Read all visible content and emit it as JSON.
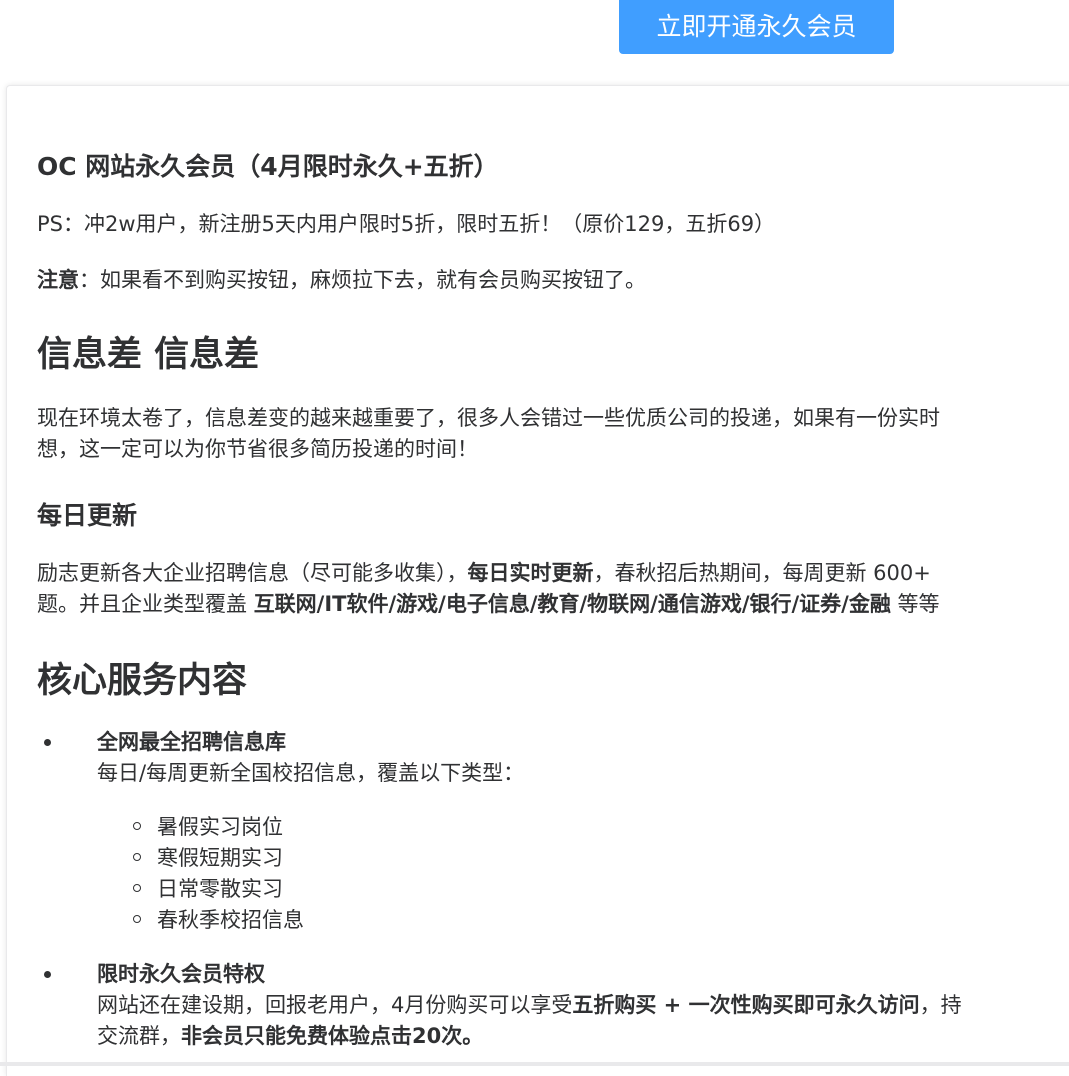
{
  "header": {
    "vip_button_label": "立即开通永久会员"
  },
  "intro": {
    "title": "OC 网站永久会员（4月限时永久+五折）",
    "ps_text": "PS：冲2w用户，新注册5天内用户限时5折，限时五折！（原价129，五折69）",
    "notice_label": "注意",
    "notice_text": "：如果看不到购买按钮，麻烦拉下去，就有会员购买按钮了。"
  },
  "info_gap": {
    "heading": "信息差 信息差",
    "line1": "现在环境太卷了，信息差变的越来越重要了，很多人会错过一些优质公司的投递，如果有一份实时",
    "line2": "想，这一定可以为你节省很多简历投递的时间！"
  },
  "daily": {
    "heading": "每日更新",
    "line1_a": "励志更新各大企业招聘信息（尽可能多收集），",
    "line1_b": "每日实时更新",
    "line1_c": "，春秋招后热期间，每周更新 600+",
    "line2_a": "题。并且企业类型覆盖 ",
    "line2_b": "互联网/IT软件/游戏/电子信息/教育/物联网/通信游戏/银行/证券/金融",
    "line2_c": " 等等"
  },
  "core": {
    "heading": "核心服务内容",
    "items": [
      {
        "title": "全网最全招聘信息库",
        "desc": "每日/每周更新全国校招信息，覆盖以下类型：",
        "sub": [
          "暑假实习岗位",
          "寒假短期实习",
          "日常零散实习",
          "春秋季校招信息"
        ]
      },
      {
        "title": "限时永久会员特权",
        "desc_a": "网站还在建设期，回报老用户，4月份购买可以享受",
        "desc_b": "五折购买 + 一次性购买即可永久访问",
        "desc_c": "，持",
        "desc2_a": "交流群，",
        "desc2_b": "非会员只能免费体验点击20次。"
      }
    ]
  },
  "colors": {
    "accent": "#409eff",
    "text": "#303133"
  }
}
